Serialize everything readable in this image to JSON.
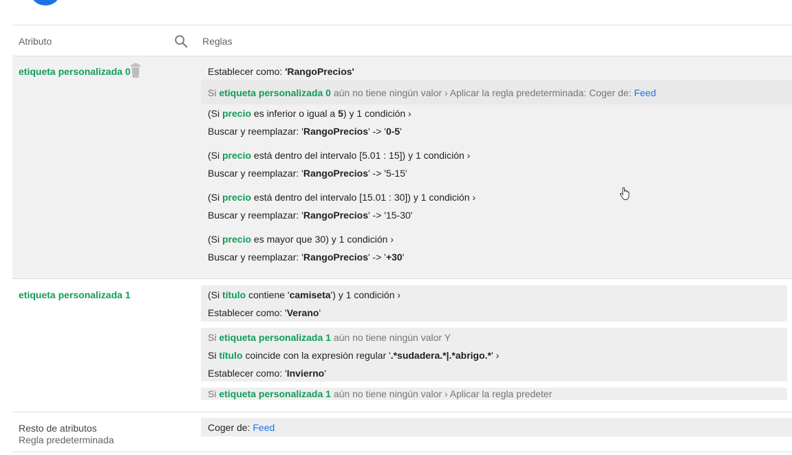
{
  "header": {
    "attribute_label": "Atributo",
    "rules_label": "Reglas"
  },
  "section0": {
    "name": "etiqueta personalizada 0",
    "set_prefix": "Establecer como: ",
    "set_value": "'RangoPrecios'",
    "default_rule": {
      "si": "Si ",
      "attr": "etiqueta personalizada 0",
      "text": " aún no tiene ningún valor › Aplicar la regla predeterminada: Coger de: ",
      "link": "Feed"
    },
    "rules": [
      {
        "open": "(Si ",
        "field": "precio",
        "cond": " es inferior o igual a ",
        "val": "5",
        "close": ") y 1 condición ›",
        "replace_prefix": "Buscar y reemplazar: '",
        "replace_key": "RangoPrecios",
        "replace_mid": "' -> '",
        "replace_val": "0-5",
        "replace_end": "'"
      },
      {
        "open": "(Si ",
        "field": "precio",
        "cond": " está dentro del intervalo ",
        "val": "[5.01 : 15]",
        "close": ") y 1 condición ›",
        "replace_prefix": "Buscar y reemplazar: '",
        "replace_key": "RangoPrecios",
        "replace_mid": "' -> '",
        "replace_val": "5-15",
        "replace_end": "'"
      },
      {
        "open": "(Si ",
        "field": "precio",
        "cond": " está dentro del intervalo ",
        "val": "[15.01 : 30]",
        "close": ") y 1 condición ›",
        "replace_prefix": "Buscar y reemplazar: '",
        "replace_key": "RangoPrecios",
        "replace_mid": "' -> '",
        "replace_val": "15-30",
        "replace_end": "'"
      },
      {
        "open": "(Si ",
        "field": "precio",
        "cond": " es mayor que ",
        "val": "30",
        "close": ") y 1 condición ›",
        "replace_prefix": "Buscar y reemplazar: '",
        "replace_key": "RangoPrecios",
        "replace_mid": "' -> '",
        "replace_val": "+30",
        "replace_end": "'"
      }
    ]
  },
  "section1": {
    "name": "etiqueta personalizada 1",
    "rule1": {
      "open": "(Si ",
      "field": "título",
      "cond": " contiene '",
      "val": "camiseta",
      "close": "') y 1 condición ›",
      "set_prefix": "Establecer como: '",
      "set_val": "Verano",
      "set_end": "'"
    },
    "rule2": {
      "si": "Si ",
      "attr": "etiqueta personalizada 1",
      "empty": " aún no tiene ningún valor Y",
      "si2": "Si ",
      "field": "título",
      "cond": " coincide con la expresión regular '",
      "val": ".*sudadera.*|.*abrigo.*",
      "close": "' ›",
      "set_prefix": "Establecer como: '",
      "set_val": "Invierno",
      "set_end": "'"
    },
    "rule3": {
      "si": "Si ",
      "attr": "etiqueta personalizada 1",
      "text": " aún no tiene ningún valor › Aplicar la regla predeter"
    }
  },
  "section2": {
    "name": "Resto de atributos",
    "sub": "Regla predeterminada",
    "rule_prefix": "Coger de: ",
    "rule_link": "Feed"
  }
}
